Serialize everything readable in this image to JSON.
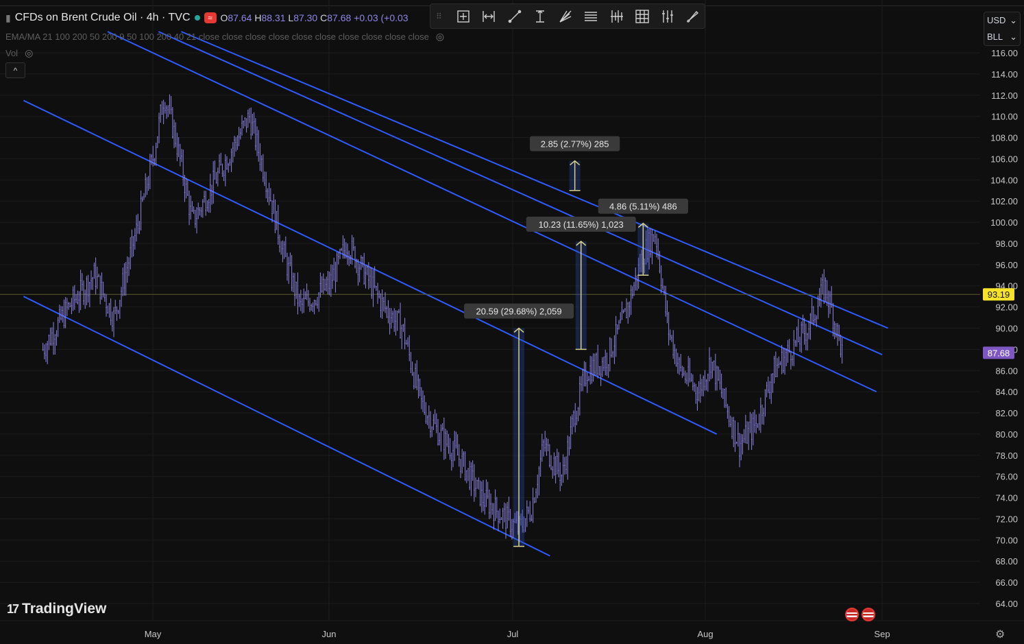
{
  "header": {
    "symbol_title": "CFDs on Brent Crude Oil · 4h · TVC",
    "ohlc": {
      "o_label": "O",
      "o": "87.64",
      "h_label": "H",
      "h": "88.31",
      "l_label": "L",
      "l": "87.30",
      "c_label": "C",
      "c": "87.68",
      "change": "+0.03 (+0.03"
    },
    "indicator_line": "EMA/MA 21 100 200 50 200 9 50 100 200 40 21 close close close close close close close close close close",
    "volume_label": "Vol",
    "collapse_glyph": "^"
  },
  "currency_box": {
    "currency": "USD",
    "unit": "BLL"
  },
  "toolbar_icons": [
    "crosshair-box-icon",
    "date-range-icon",
    "trend-line-icon",
    "fib-icon",
    "pitchfork-icon",
    "lines-icon",
    "measure-icon",
    "grid-icon",
    "adjust-icon",
    "brush-icon"
  ],
  "branding": {
    "logo_mark": "17",
    "logo_text": "TradingView"
  },
  "colors": {
    "background": "#0f0f0f",
    "candles": "#8e86e6",
    "channel": "#2f5bff",
    "measure": "#d6d08a",
    "current_price_label": "#7e57c2",
    "horizontal_line_label": "#f7e22b"
  },
  "chart_data": {
    "type": "candlestick",
    "x_ticks": [
      "May",
      "Jun",
      "Jul",
      "Aug",
      "Sep"
    ],
    "y_ticks": [
      "116.00",
      "114.00",
      "112.00",
      "110.00",
      "108.00",
      "106.00",
      "104.00",
      "102.00",
      "100.00",
      "98.00",
      "96.00",
      "94.00",
      "92.00",
      "90.00",
      "88.00",
      "86.00",
      "84.00",
      "82.00",
      "80.00",
      "78.00",
      "76.00",
      "74.00",
      "72.00",
      "70.00",
      "68.00",
      "66.00",
      "64.00"
    ],
    "ylim": [
      62,
      118
    ],
    "current_price": "87.68",
    "horizontal_line_price": "93.19",
    "price_path": [
      {
        "date": "Apr 14",
        "price": 88
      },
      {
        "date": "Apr 18",
        "price": 92
      },
      {
        "date": "Apr 22",
        "price": 95
      },
      {
        "date": "Apr 25",
        "price": 91
      },
      {
        "date": "Apr 28",
        "price": 98
      },
      {
        "date": "May 1",
        "price": 106
      },
      {
        "date": "May 3",
        "price": 112
      },
      {
        "date": "May 5",
        "price": 108
      },
      {
        "date": "May 8",
        "price": 100
      },
      {
        "date": "May 11",
        "price": 103
      },
      {
        "date": "May 14",
        "price": 106
      },
      {
        "date": "May 18",
        "price": 110
      },
      {
        "date": "May 21",
        "price": 104
      },
      {
        "date": "May 24",
        "price": 97
      },
      {
        "date": "May 27",
        "price": 92
      },
      {
        "date": "Jun 1",
        "price": 94
      },
      {
        "date": "Jun 4",
        "price": 98
      },
      {
        "date": "Jun 7",
        "price": 95
      },
      {
        "date": "Jun 10",
        "price": 92
      },
      {
        "date": "Jun 13",
        "price": 90
      },
      {
        "date": "Jun 16",
        "price": 83
      },
      {
        "date": "Jun 19",
        "price": 80
      },
      {
        "date": "Jun 22",
        "price": 78
      },
      {
        "date": "Jun 26",
        "price": 74
      },
      {
        "date": "Jun 30",
        "price": 72
      },
      {
        "date": "Jul 2",
        "price": 71
      },
      {
        "date": "Jul 4",
        "price": 73
      },
      {
        "date": "Jul 6",
        "price": 79
      },
      {
        "date": "Jul 9",
        "price": 76
      },
      {
        "date": "Jul 11",
        "price": 82
      },
      {
        "date": "Jul 13",
        "price": 86
      },
      {
        "date": "Jul 16",
        "price": 87
      },
      {
        "date": "Jul 19",
        "price": 91
      },
      {
        "date": "Jul 22",
        "price": 97
      },
      {
        "date": "Jul 24",
        "price": 99
      },
      {
        "date": "Jul 26",
        "price": 90
      },
      {
        "date": "Jul 28",
        "price": 86
      },
      {
        "date": "Jul 31",
        "price": 84
      },
      {
        "date": "Aug 2",
        "price": 87
      },
      {
        "date": "Aug 5",
        "price": 82
      },
      {
        "date": "Aug 7",
        "price": 79
      },
      {
        "date": "Aug 10",
        "price": 81
      },
      {
        "date": "Aug 13",
        "price": 86
      },
      {
        "date": "Aug 16",
        "price": 88
      },
      {
        "date": "Aug 19",
        "price": 90
      },
      {
        "date": "Aug 22",
        "price": 94
      },
      {
        "date": "Aug 24",
        "price": 90
      },
      {
        "date": "Aug 25",
        "price": 87.68
      }
    ],
    "measurements": [
      {
        "label": "2.85 (2.77%) 285",
        "date": "Jul 11",
        "from": 103,
        "to": 105.8
      },
      {
        "label": "10.23 (11.65%) 1,023",
        "date": "Jul 12",
        "from": 88,
        "to": 98.2
      },
      {
        "label": "4.86 (5.11%) 486",
        "date": "Jul 22",
        "from": 95,
        "to": 99.9
      },
      {
        "label": "20.59 (29.68%) 2,059",
        "date": "Jul 2",
        "from": 69.4,
        "to": 90
      }
    ],
    "channels": [
      {
        "from": {
          "date": "Apr 11",
          "price": 93
        },
        "to": {
          "date": "Jul 7",
          "price": 68.5
        }
      },
      {
        "from": {
          "date": "Apr 11",
          "price": 111.5
        },
        "to": {
          "date": "Aug 3",
          "price": 80
        }
      },
      {
        "from": {
          "date": "Apr 24",
          "price": 118
        },
        "to": {
          "date": "Aug 31",
          "price": 84
        }
      },
      {
        "from": {
          "date": "May 2",
          "price": 118
        },
        "to": {
          "date": "Sep 1",
          "price": 87.5
        }
      },
      {
        "from": {
          "date": "May 6",
          "price": 118
        },
        "to": {
          "date": "Sep 2",
          "price": 90
        }
      }
    ]
  }
}
